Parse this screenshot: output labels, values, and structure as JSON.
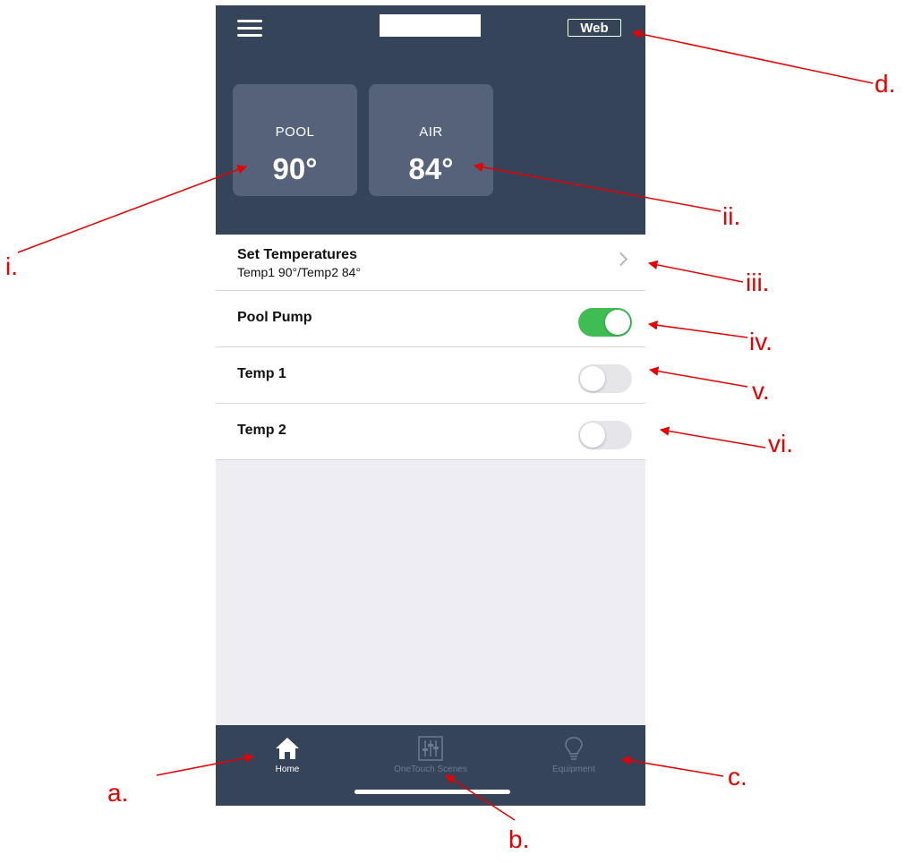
{
  "header": {
    "web_button": "Web"
  },
  "tiles": [
    {
      "label": "POOL",
      "value": "90°"
    },
    {
      "label": "AIR",
      "value": "84°"
    }
  ],
  "rows": {
    "set_temperatures": {
      "title": "Set Temperatures",
      "subtitle": "Temp1 90°/Temp2 84°"
    },
    "pool_pump": {
      "title": "Pool Pump",
      "state": "on"
    },
    "temp1": {
      "title": "Temp 1",
      "state": "off"
    },
    "temp2": {
      "title": "Temp 2",
      "state": "off"
    }
  },
  "tabbar": {
    "tabs": [
      {
        "label": "Home",
        "icon": "home-icon",
        "active": true
      },
      {
        "label": "OneTouch Scenes",
        "icon": "sliders-icon",
        "active": false
      },
      {
        "label": "Equipment",
        "icon": "lightbulb-icon",
        "active": false
      }
    ]
  },
  "annotations": {
    "a": "a.",
    "b": "b.",
    "c": "c.",
    "d": "d.",
    "i": "i.",
    "ii": "ii.",
    "iii": "iii.",
    "iv": "iv.",
    "v": "v.",
    "vi": "vi."
  },
  "colors": {
    "header_bg": "#36445a",
    "tile_bg": "#56627a",
    "toggle_on": "#3fbd53",
    "toggle_off": "#e6e6ea",
    "annotation": "#e60000",
    "content_bg": "#eeedf3"
  }
}
